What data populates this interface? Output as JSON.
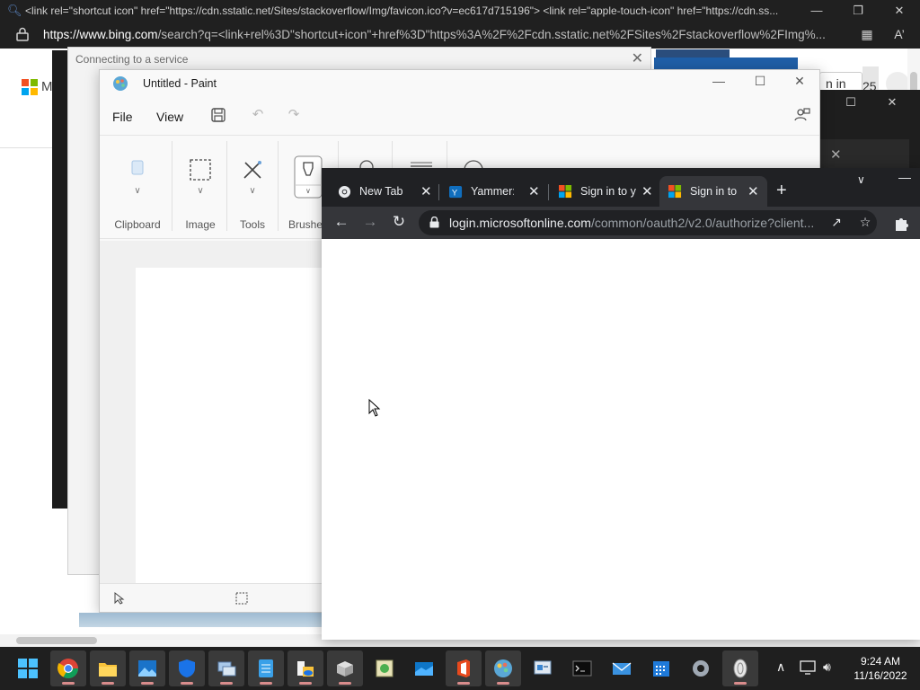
{
  "edge": {
    "tab_title": "<link rel=\"shortcut icon\" href=\"https://cdn.sstatic.net/Sites/stackoverflow/Img/favicon.ico?v=ec617d715196\"> <link rel=\"apple-touch-icon\" href=\"https://cdn.ss...",
    "url_domain": "https://www.bing.com",
    "url_rest": "/search?q=<link+rel%3D\"shortcut+icon\"+href%3D\"https%3A%2F%2Fcdn.sstatic.net%2FSites%2Fstackoverflow%2FImg%...",
    "logo_letter": "M",
    "signin_partial": "n in",
    "count": "25",
    "bg_color": "#202020"
  },
  "connect_dialog": {
    "title": "Connecting to a service"
  },
  "paint": {
    "title": "Untitled - Paint",
    "menu": {
      "file": "File",
      "view": "View"
    },
    "ribbon": {
      "clipboard": "Clipboard",
      "image": "Image",
      "tools": "Tools",
      "brushes": "Brushe"
    }
  },
  "chrome": {
    "tabs": [
      {
        "label": "New Tab",
        "icon": "chrome-icon"
      },
      {
        "label": "Yammer: W",
        "icon": "yammer-icon"
      },
      {
        "label": "Sign in to y",
        "icon": "microsoft-icon"
      },
      {
        "label": "Sign in to",
        "icon": "microsoft-icon",
        "active": true
      }
    ],
    "url_domain": "login.microsoftonline.com",
    "url_path": "/common/oauth2/v2.0/authorize?client...",
    "toolbar_color": "#35363a",
    "tabbar_color": "#202124"
  },
  "taskbar": {
    "apps": [
      "chrome-icon",
      "file-explorer-icon",
      "photos-icon",
      "defender-icon",
      "remote-desktop-icon",
      "notepad-icon",
      "onedrive-folder-icon",
      "package-icon",
      "ftp-icon",
      "mail-landscape-icon",
      "office-icon",
      "paint-icon",
      "control-panel-icon",
      "terminal-icon",
      "mail-icon",
      "calendar-icon",
      "settings-icon",
      "media-icon"
    ],
    "time": "9:24 AM",
    "date": "11/16/2022"
  }
}
